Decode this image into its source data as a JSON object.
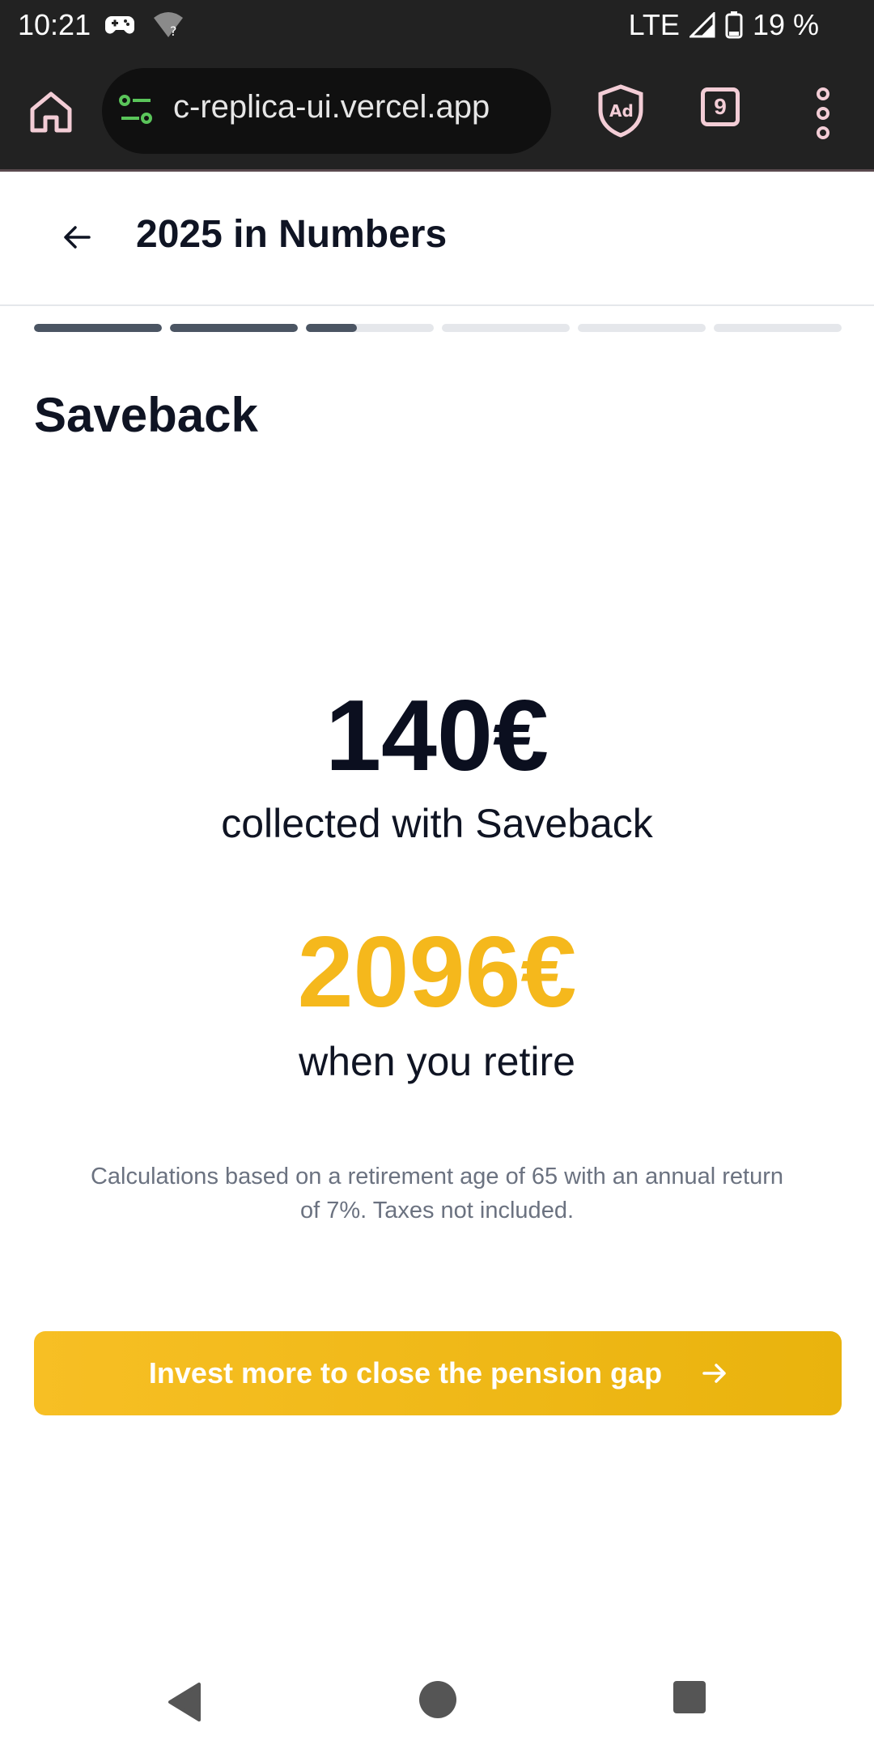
{
  "status_bar": {
    "time": "10:21",
    "network": "LTE",
    "battery": "19 %"
  },
  "browser": {
    "url": "c-replica-ui.vercel.app",
    "tab_count": "9",
    "icons": [
      "home-icon",
      "site-settings-icon",
      "adblock-icon",
      "tabs-icon",
      "more-menu-icon"
    ]
  },
  "header": {
    "title": "2025 in Numbers"
  },
  "progress": {
    "segments": [
      1,
      1,
      0.4,
      0,
      0,
      0
    ]
  },
  "section": {
    "title": "Saveback"
  },
  "stats": {
    "collected_amount": "140€",
    "collected_label": "collected with Saveback",
    "retire_amount": "2096€",
    "retire_label": "when you retire"
  },
  "disclaimer": "Calculations based on a retirement age of 65 with an annual return of 7%. Taxes not included.",
  "cta": {
    "label": "Invest more to close the pension gap"
  },
  "colors": {
    "accent": "#f5b81c",
    "primary_text": "#0f1423",
    "muted_text": "#6b7280"
  }
}
